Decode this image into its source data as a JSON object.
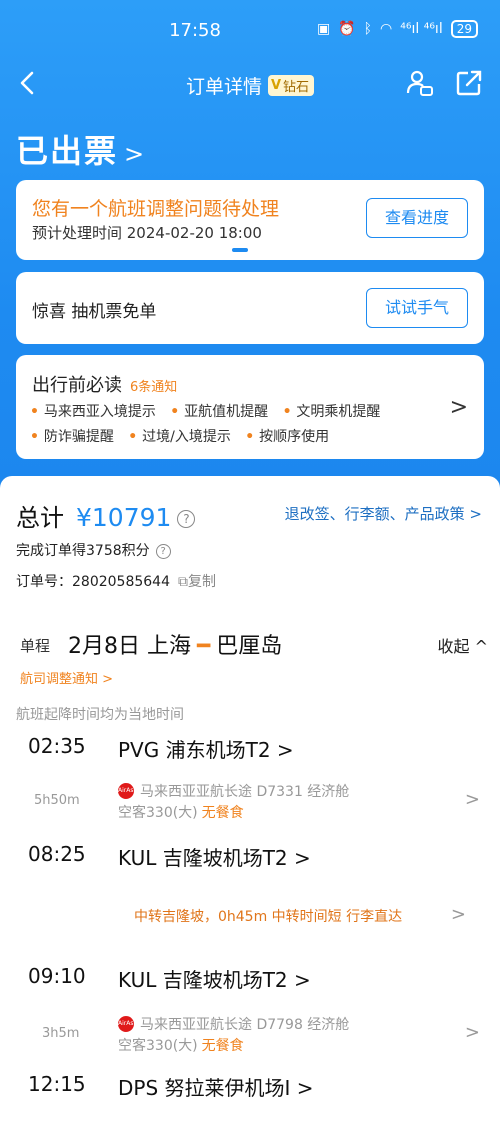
{
  "status_bar": {
    "time": "17:58",
    "signal": "⁴⁶ıl ⁴⁶ıl",
    "battery": "29"
  },
  "nav": {
    "title": "订单详情",
    "badge_text": "钻石"
  },
  "order_status": "已出票",
  "notice_card": {
    "title": "您有一个航班调整问题待处理",
    "subtitle": "预计处理时间 2024-02-20 18:00",
    "button": "查看进度"
  },
  "lucky_card": {
    "text": "惊喜 抽机票免单",
    "button": "试试手气"
  },
  "travel_notice": {
    "title": "出行前必读",
    "count": "6条通知",
    "items_row1": [
      "马来西亚入境提示",
      "亚航值机提醒",
      "文明乘机提醒"
    ],
    "items_row2": [
      "防诈骗提醒",
      "过境/入境提示",
      "按顺序使用"
    ]
  },
  "summary": {
    "total_label": "总计",
    "price": "¥10791",
    "policy_link": "退改签、行李额、产品政策",
    "points": "完成订单得3758积分",
    "order_no_label": "订单号：",
    "order_no": "28020585644",
    "copy": "复制"
  },
  "route": {
    "tag": "单程",
    "date": "2月8日",
    "from": "上海",
    "to": "巴厘岛",
    "collapse": "收起",
    "adjust_notice": "航司调整通知",
    "local_time_note": "航班起降时间均为当地时间"
  },
  "segments": [
    {
      "time": "02:35",
      "airport": "PVG  浦东机场T2"
    },
    {
      "time": "08:25",
      "airport": "KUL  吉隆坡机场T2"
    },
    {
      "time": "09:10",
      "airport": "KUL  吉隆坡机场T2"
    },
    {
      "time": "12:15",
      "airport": "DPS  努拉莱伊机场I"
    }
  ],
  "flights": [
    {
      "duration": "5h50m",
      "airline_flight": "马来西亚亚航长途 D7331  经济舱",
      "aircraft": "空客330(大)",
      "meal": "无餐食"
    },
    {
      "duration": "3h5m",
      "airline_flight": "马来西亚亚航长途 D7798  经济舱",
      "aircraft": "空客330(大)",
      "meal": "无餐食"
    }
  ],
  "transfer": "中转吉隆坡，0h45m 中转时间短 行李直达",
  "colors": {
    "primary": "#1e8bf1",
    "accent": "#f0831f"
  }
}
